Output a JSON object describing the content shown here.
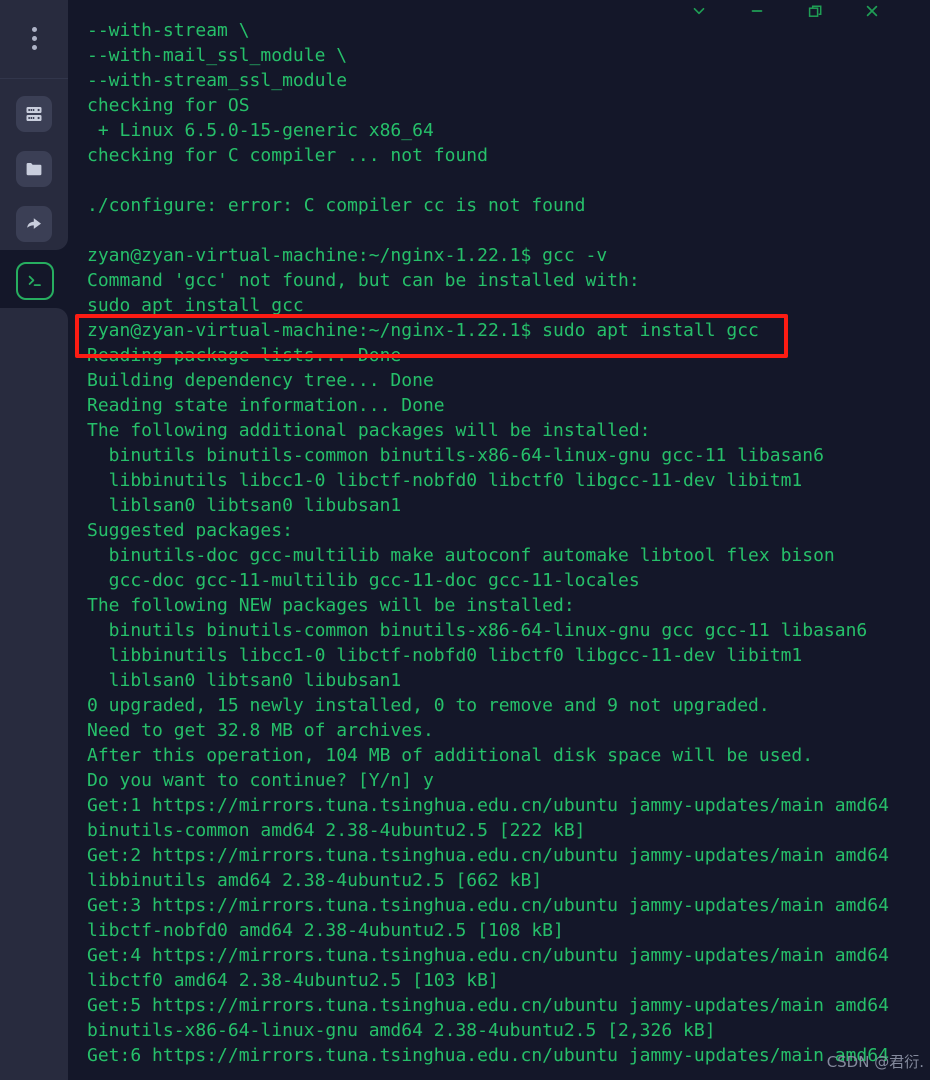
{
  "window": {
    "controls": [
      {
        "name": "chevron-down",
        "label": "Collapse"
      },
      {
        "name": "minimize",
        "label": "Minimize"
      },
      {
        "name": "maximize",
        "label": "Restore"
      },
      {
        "name": "close",
        "label": "Close"
      }
    ],
    "accent_green": "#27ae60",
    "terminal_bg": "#141729",
    "sidebar_bg": "#282b3e",
    "text_green": "#26c06a",
    "highlight_red": "#fc1c13"
  },
  "sidebar": {
    "items": [
      {
        "id": "more-menu",
        "icon": "kebab-menu-icon",
        "label": "More"
      },
      {
        "id": "servers",
        "icon": "server-rack-icon",
        "label": "Servers"
      },
      {
        "id": "files",
        "icon": "folder-icon",
        "label": "Files"
      },
      {
        "id": "transfer",
        "icon": "forward-arrow-icon",
        "label": "Transfer"
      },
      {
        "id": "terminal",
        "icon": "terminal-icon",
        "label": "Terminal",
        "active": true
      }
    ]
  },
  "terminal": {
    "lines": [
      "--with-stream \\",
      "--with-mail_ssl_module \\",
      "--with-stream_ssl_module",
      "checking for OS",
      " + Linux 6.5.0-15-generic x86_64",
      "checking for C compiler ... not found",
      "",
      "./configure: error: C compiler cc is not found",
      "",
      "zyan@zyan-virtual-machine:~/nginx-1.22.1$ gcc -v",
      "Command 'gcc' not found, but can be installed with:",
      "sudo apt install gcc",
      "zyan@zyan-virtual-machine:~/nginx-1.22.1$ sudo apt install gcc",
      "Reading package lists... Done",
      "Building dependency tree... Done",
      "Reading state information... Done",
      "The following additional packages will be installed:",
      "  binutils binutils-common binutils-x86-64-linux-gnu gcc-11 libasan6",
      "  libbinutils libcc1-0 libctf-nobfd0 libctf0 libgcc-11-dev libitm1",
      "  liblsan0 libtsan0 libubsan1",
      "Suggested packages:",
      "  binutils-doc gcc-multilib make autoconf automake libtool flex bison",
      "  gcc-doc gcc-11-multilib gcc-11-doc gcc-11-locales",
      "The following NEW packages will be installed:",
      "  binutils binutils-common binutils-x86-64-linux-gnu gcc gcc-11 libasan6",
      "  libbinutils libcc1-0 libctf-nobfd0 libctf0 libgcc-11-dev libitm1",
      "  liblsan0 libtsan0 libubsan1",
      "0 upgraded, 15 newly installed, 0 to remove and 9 not upgraded.",
      "Need to get 32.8 MB of archives.",
      "After this operation, 104 MB of additional disk space will be used.",
      "Do you want to continue? [Y/n] y",
      "Get:1 https://mirrors.tuna.tsinghua.edu.cn/ubuntu jammy-updates/main amd64",
      "binutils-common amd64 2.38-4ubuntu2.5 [222 kB]",
      "Get:2 https://mirrors.tuna.tsinghua.edu.cn/ubuntu jammy-updates/main amd64",
      "libbinutils amd64 2.38-4ubuntu2.5 [662 kB]",
      "Get:3 https://mirrors.tuna.tsinghua.edu.cn/ubuntu jammy-updates/main amd64",
      "libctf-nobfd0 amd64 2.38-4ubuntu2.5 [108 kB]",
      "Get:4 https://mirrors.tuna.tsinghua.edu.cn/ubuntu jammy-updates/main amd64",
      "libctf0 amd64 2.38-4ubuntu2.5 [103 kB]",
      "Get:5 https://mirrors.tuna.tsinghua.edu.cn/ubuntu jammy-updates/main amd64",
      "binutils-x86-64-linux-gnu amd64 2.38-4ubuntu2.5 [2,326 kB]",
      "Get:6 https://mirrors.tuna.tsinghua.edu.cn/ubuntu jammy-updates/main amd64"
    ],
    "highlighted_line": "zyan@zyan-virtual-machine:~/nginx-1.22.1$ sudo apt install gcc"
  },
  "watermark": {
    "text": "CSDN @君衍."
  }
}
